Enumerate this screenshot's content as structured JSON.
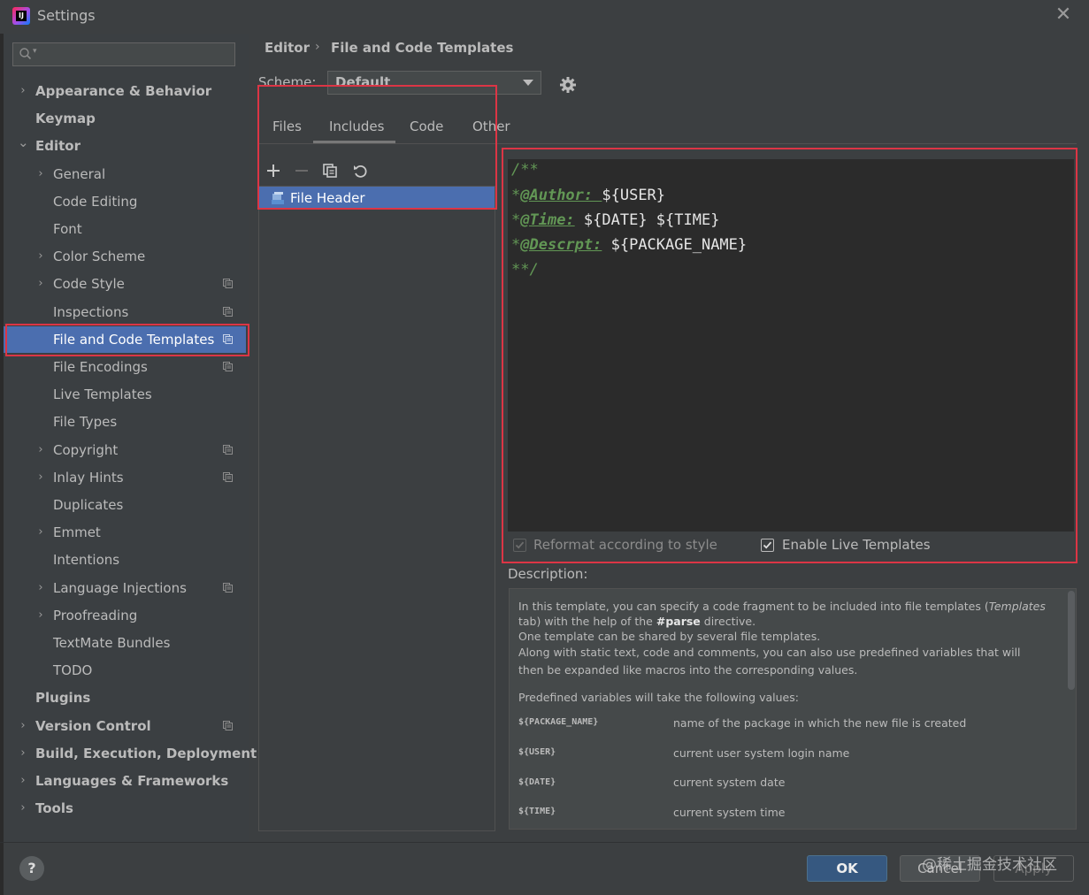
{
  "window": {
    "title": "Settings"
  },
  "sidebar": {
    "search_placeholder": "",
    "items": [
      {
        "label": "Appearance & Behavior",
        "level": 0,
        "expandable": true,
        "expanded": false,
        "bold": true,
        "project": false,
        "selected": false
      },
      {
        "label": "Keymap",
        "level": 0,
        "expandable": false,
        "bold": true,
        "project": false,
        "selected": false
      },
      {
        "label": "Editor",
        "level": 0,
        "expandable": true,
        "expanded": true,
        "bold": true,
        "project": false,
        "selected": false
      },
      {
        "label": "General",
        "level": 1,
        "expandable": true,
        "expanded": false,
        "bold": false,
        "project": false,
        "selected": false
      },
      {
        "label": "Code Editing",
        "level": 1,
        "expandable": false,
        "bold": false,
        "project": false,
        "selected": false
      },
      {
        "label": "Font",
        "level": 1,
        "expandable": false,
        "bold": false,
        "project": false,
        "selected": false
      },
      {
        "label": "Color Scheme",
        "level": 1,
        "expandable": true,
        "expanded": false,
        "bold": false,
        "project": false,
        "selected": false
      },
      {
        "label": "Code Style",
        "level": 1,
        "expandable": true,
        "expanded": false,
        "bold": false,
        "project": true,
        "selected": false
      },
      {
        "label": "Inspections",
        "level": 1,
        "expandable": false,
        "bold": false,
        "project": true,
        "selected": false
      },
      {
        "label": "File and Code Templates",
        "level": 1,
        "expandable": false,
        "bold": false,
        "project": true,
        "selected": true
      },
      {
        "label": "File Encodings",
        "level": 1,
        "expandable": false,
        "bold": false,
        "project": true,
        "selected": false
      },
      {
        "label": "Live Templates",
        "level": 1,
        "expandable": false,
        "bold": false,
        "project": false,
        "selected": false
      },
      {
        "label": "File Types",
        "level": 1,
        "expandable": false,
        "bold": false,
        "project": false,
        "selected": false
      },
      {
        "label": "Copyright",
        "level": 1,
        "expandable": true,
        "expanded": false,
        "bold": false,
        "project": true,
        "selected": false
      },
      {
        "label": "Inlay Hints",
        "level": 1,
        "expandable": true,
        "expanded": false,
        "bold": false,
        "project": true,
        "selected": false
      },
      {
        "label": "Duplicates",
        "level": 1,
        "expandable": false,
        "bold": false,
        "project": false,
        "selected": false
      },
      {
        "label": "Emmet",
        "level": 1,
        "expandable": true,
        "expanded": false,
        "bold": false,
        "project": false,
        "selected": false
      },
      {
        "label": "Intentions",
        "level": 1,
        "expandable": false,
        "bold": false,
        "project": false,
        "selected": false
      },
      {
        "label": "Language Injections",
        "level": 1,
        "expandable": true,
        "expanded": false,
        "bold": false,
        "project": true,
        "selected": false
      },
      {
        "label": "Proofreading",
        "level": 1,
        "expandable": true,
        "expanded": false,
        "bold": false,
        "project": false,
        "selected": false
      },
      {
        "label": "TextMate Bundles",
        "level": 1,
        "expandable": false,
        "bold": false,
        "project": false,
        "selected": false
      },
      {
        "label": "TODO",
        "level": 1,
        "expandable": false,
        "bold": false,
        "project": false,
        "selected": false
      },
      {
        "label": "Plugins",
        "level": 0,
        "expandable": false,
        "bold": true,
        "project": false,
        "selected": false
      },
      {
        "label": "Version Control",
        "level": 0,
        "expandable": true,
        "expanded": false,
        "bold": true,
        "project": true,
        "selected": false
      },
      {
        "label": "Build, Execution, Deployment",
        "level": 0,
        "expandable": true,
        "expanded": false,
        "bold": true,
        "project": false,
        "selected": false
      },
      {
        "label": "Languages & Frameworks",
        "level": 0,
        "expandable": true,
        "expanded": false,
        "bold": true,
        "project": false,
        "selected": false
      },
      {
        "label": "Tools",
        "level": 0,
        "expandable": true,
        "expanded": false,
        "bold": true,
        "project": false,
        "selected": false
      }
    ]
  },
  "breadcrumb": {
    "parent": "Editor",
    "separator": "›",
    "current": "File and Code Templates"
  },
  "scheme": {
    "label": "Scheme:",
    "value": "Default"
  },
  "tabs": [
    {
      "label": "Files",
      "active": false
    },
    {
      "label": "Includes",
      "active": true
    },
    {
      "label": "Code",
      "active": false
    },
    {
      "label": "Other",
      "active": false
    }
  ],
  "templates_list": {
    "items": [
      {
        "label": "File Header",
        "selected": true
      }
    ]
  },
  "editor": {
    "lines": [
      [
        {
          "t": "/**",
          "c": "comment"
        }
      ],
      [
        {
          "t": "*",
          "c": "comment"
        },
        {
          "t": "@Author: ",
          "c": "tag"
        },
        {
          "t": "${USER}",
          "c": "var"
        }
      ],
      [
        {
          "t": "*",
          "c": "comment"
        },
        {
          "t": "@Time:",
          "c": "tag"
        },
        {
          "t": " ${DATE} ${TIME}",
          "c": "var"
        }
      ],
      [
        {
          "t": "*",
          "c": "comment"
        },
        {
          "t": "@Descrpt:",
          "c": "tag"
        },
        {
          "t": " ${PACKAGE_NAME}",
          "c": "var"
        }
      ],
      [
        {
          "t": "**/",
          "c": "comment"
        }
      ]
    ],
    "reformat_label": "Reformat according to style",
    "reformat_checked": true,
    "reformat_enabled": false,
    "live_templates_label": "Enable Live Templates",
    "live_templates_checked": true
  },
  "description": {
    "title": "Description:",
    "para_lines": [
      "In this template, you can specify a code fragment to be included into file templates (Templates",
      "tab) with the help of the #parse directive.",
      "One template can be shared by several file templates.",
      "Along with static text, code and comments, you can also use predefined variables that will",
      "then be expanded like macros into the corresponding values."
    ],
    "vars_intro": "Predefined variables will take the following values:",
    "variables": [
      {
        "name": "${PACKAGE_NAME}",
        "desc": "name of the package in which the new file is created"
      },
      {
        "name": "${USER}",
        "desc": "current user system login name"
      },
      {
        "name": "${DATE}",
        "desc": "current system date"
      },
      {
        "name": "${TIME}",
        "desc": "current system time"
      }
    ]
  },
  "buttons": {
    "help": "?",
    "ok": "OK",
    "cancel": "Cancel",
    "apply": "Apply"
  },
  "watermark": "@稀土掘金技术社区",
  "colors": {
    "background": "#3c3f41",
    "selection": "#4b6eaf",
    "editor_bg": "#2b2b2b",
    "comment_green": "#629755",
    "annotation_outline": "#dc3545",
    "ok_button": "#365880"
  }
}
